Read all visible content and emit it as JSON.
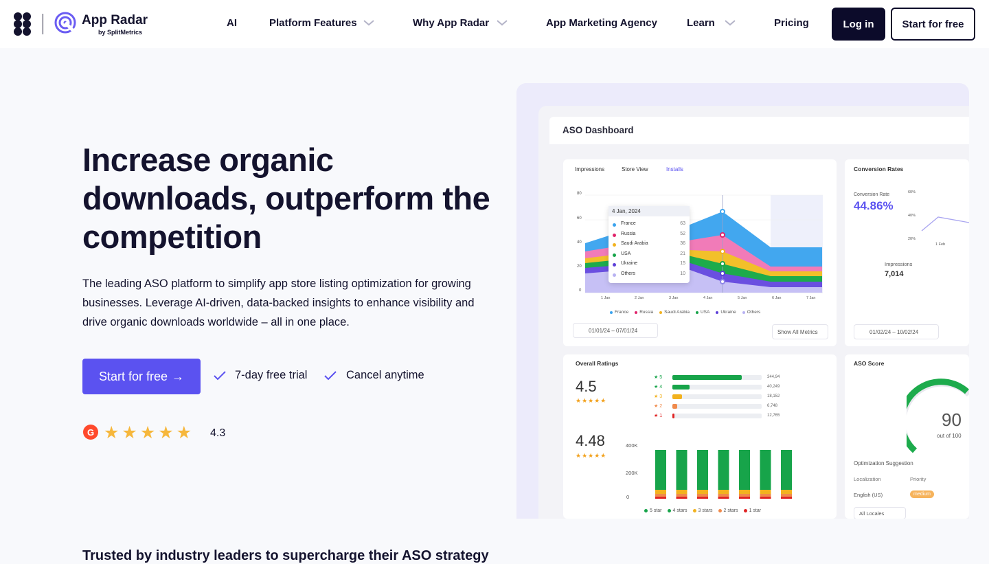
{
  "nav": {
    "brand": "App Radar",
    "brand_sub": "by SplitMetrics",
    "items": [
      "AI",
      "Platform Features",
      "Why App Radar",
      "App Marketing Agency",
      "Learn",
      "Pricing"
    ],
    "login": "Log in",
    "start": "Start for free"
  },
  "hero": {
    "title": "Increase organic downloads, outperform the competition",
    "description": "The leading ASO platform to simplify app store listing optimization for growing businesses. Leverage AI-driven, data-backed insights to enhance visibility and drive organic downloads worldwide – all in one place.",
    "cta": "Start for free",
    "cta_arrow": "→",
    "perks": [
      "7-day free trial",
      "Cancel anytime"
    ],
    "g2_badge": "G",
    "stars": "★★★★★",
    "rating": "4.3"
  },
  "trusted": "Trusted by industry leaders to supercharge their ASO strategy",
  "dashboard": {
    "title": "ASO Dashboard",
    "tabs": [
      "Impressions",
      "Store View",
      "Installs"
    ],
    "active_tab": "Installs",
    "y_ticks": [
      "80",
      "60",
      "40",
      "20",
      "0"
    ],
    "x_ticks": [
      "1 Jan",
      "2 Jan",
      "3 Jan",
      "4 Jan",
      "5 Jan",
      "6 Jan",
      "7 Jan"
    ],
    "tooltip": {
      "date": "4 Jan, 2024",
      "rows": [
        {
          "label": "France",
          "value": "63",
          "color": "#3aa3ee"
        },
        {
          "label": "Russia",
          "value": "52",
          "color": "#e0246b"
        },
        {
          "label": "Saudi Arabia",
          "value": "36",
          "color": "#f2b21f"
        },
        {
          "label": "USA",
          "value": "21",
          "color": "#17a44a"
        },
        {
          "label": "Ukraine",
          "value": "15",
          "color": "#5d40d8"
        },
        {
          "label": "Others",
          "value": "10",
          "color": "#b8b2f2"
        }
      ]
    },
    "legend": [
      "France",
      "Russia",
      "Saudi Arabia",
      "USA",
      "Ukraine",
      "Others"
    ],
    "date_range": "01/01/24 – 07/01/24",
    "show_all": "Show All Metrics",
    "conversion": {
      "title": "Conversion Rates",
      "label": "Conversion Rate",
      "value": "44.86%",
      "y_ticks": [
        "60%",
        "40%",
        "20%"
      ],
      "x_tick": "1 Feb",
      "impressions_label": "Impressions",
      "impressions_value": "7,014",
      "date_range": "01/02/24 – 10/02/24"
    },
    "ratings": {
      "title": "Overall Ratings",
      "score_1": "4.5",
      "score_2": "4.48",
      "mini_stars": "★★★★★",
      "rows": [
        {
          "star": "5",
          "count": "344,94",
          "fill": 0.78,
          "color": "#17a44a"
        },
        {
          "star": "4",
          "count": "40,249",
          "fill": 0.19,
          "color": "#17a44a"
        },
        {
          "star": "3",
          "count": "18,152",
          "fill": 0.11,
          "color": "#f2b21f"
        },
        {
          "star": "2",
          "count": "6,748",
          "fill": 0.05,
          "color": "#f08a4b"
        },
        {
          "star": "1",
          "count": "12,765",
          "fill": 0.02,
          "color": "#e02424"
        }
      ],
      "bar_y_ticks": [
        "400K",
        "200K",
        "0"
      ],
      "bar_legend": [
        "5 star",
        "4 stars",
        "3 stars",
        "2 stars",
        "1 star"
      ],
      "bar_legend_colors": [
        "#17a44a",
        "#17a44a",
        "#f2b21f",
        "#f08a4b",
        "#e02424"
      ]
    },
    "aso_score": {
      "title": "ASO Score",
      "value": "90",
      "out_of": "out of 100",
      "suggestion": "Optimization Suggestion",
      "col_1": "Localization",
      "col_2": "Priority",
      "row_locale": "English (US)",
      "row_priority": "medium",
      "locales": "All Locales"
    }
  }
}
